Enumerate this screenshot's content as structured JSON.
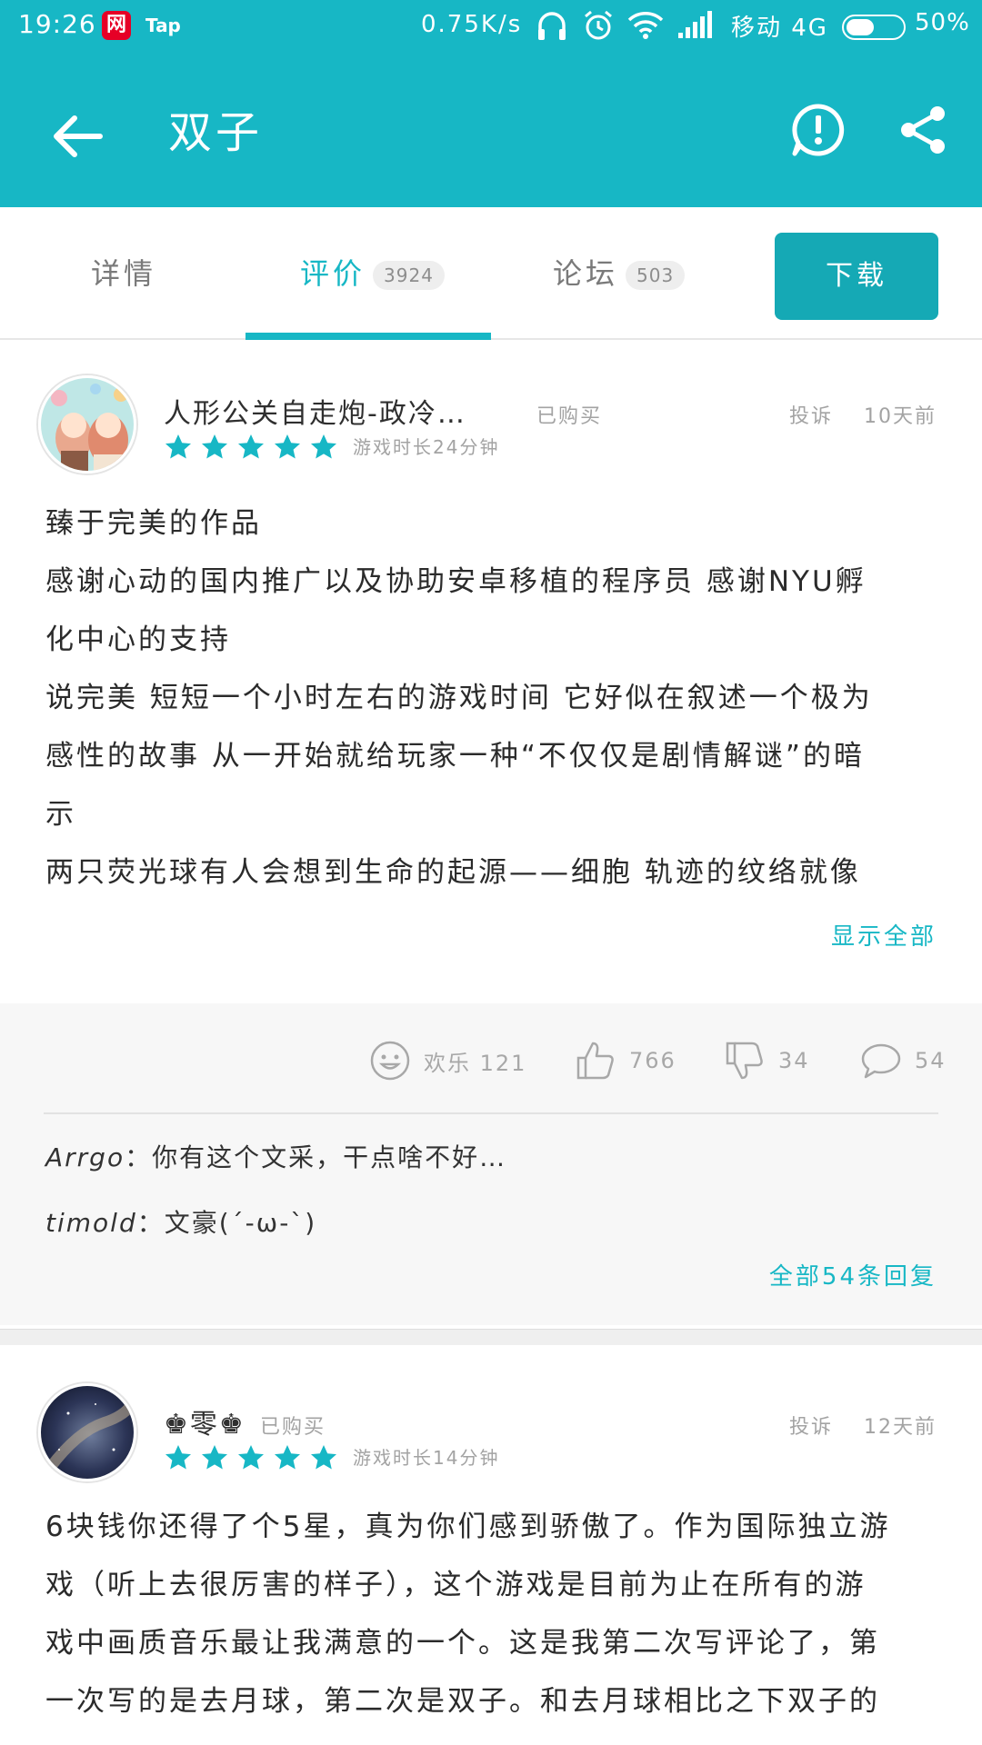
{
  "status_bar": {
    "time": "19:26",
    "netease_icon": "网",
    "tap_label": "Tap",
    "speed": "0.75K/s",
    "carrier": "移动 4G",
    "battery_level": 0.5,
    "battery_pct": "50%"
  },
  "appbar": {
    "title": "双子",
    "icons": [
      "back-arrow-icon",
      "report-icon",
      "share-icon"
    ]
  },
  "tabs": [
    {
      "label": "详情",
      "count": ""
    },
    {
      "label": "评价",
      "count": "3924"
    },
    {
      "label": "论坛",
      "count": "503"
    }
  ],
  "download_label": "下载",
  "reviews": [
    {
      "user": "人形公关自走炮-政冷…",
      "bought": "已购买",
      "report": "投诉",
      "time": "10天前",
      "rating": 5,
      "playtime": "游戏时长24分钟",
      "lines": [
        "臻于完美的作品",
        "感谢心动的国内推广以及协助安卓移植的程序员 感谢NYU孵",
        "化中心的支持",
        "说完美 短短一个小时左右的游戏时间 它好似在叙述一个极为",
        "感性的故事 从一开始就给玩家一种“不仅仅是剧情解谜”的暗",
        "示",
        "两只荧光球有人会想到生命的起源——细胞 轨迹的纹络就像"
      ],
      "show_all": "显示全部",
      "actions": {
        "funny": "欢乐 121",
        "like": "766",
        "dislike": "34",
        "comments": "54"
      },
      "replies": [
        {
          "name": "Arrgo",
          "text": "：你有这个文采，干点啥不好…"
        },
        {
          "name": "timold",
          "text": "：文豪(´-ω-`)"
        }
      ],
      "all_replies": "全部54条回复"
    },
    {
      "user": "♚零♚",
      "bought": "已购买",
      "report": "投诉",
      "time": "12天前",
      "rating": 5,
      "playtime": "游戏时长14分钟",
      "lines": [
        "6块钱你还得了个5星，真为你们感到骄傲了。作为国际独立游",
        "戏（听上去很厉害的样子），这个游戏是目前为止在所有的游",
        "戏中画质音乐最让我满意的一个。这是我第二次写评论了，第",
        "一次写的是去月球，第二次是双子。和去月球相比之下双子的"
      ]
    }
  ],
  "colors": {
    "accent": "#17b7c5",
    "download": "#15a9b5",
    "star": "#17b7c5",
    "netease": "#e60026"
  }
}
